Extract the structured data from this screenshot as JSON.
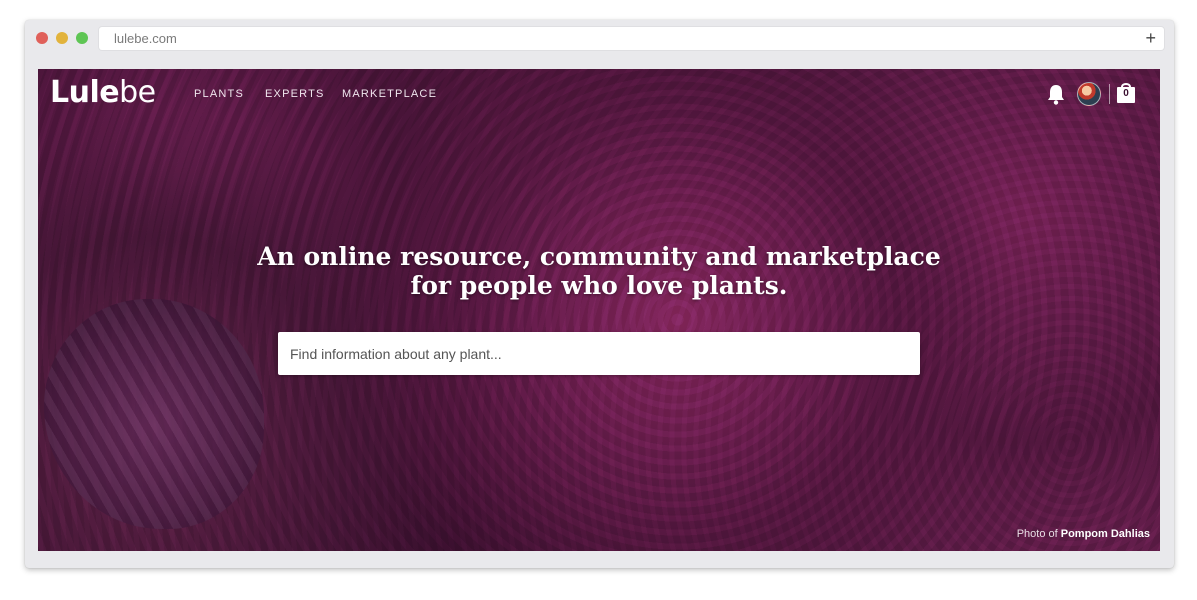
{
  "browser": {
    "url": "lulebe.com",
    "new_tab_symbol": "+",
    "traffic_lights": {
      "close": "#e0605a",
      "minimize": "#e2b33c",
      "maximize": "#5ec554"
    }
  },
  "site": {
    "logo_bold": "Lule",
    "logo_light": "be",
    "nav": [
      {
        "label": "PLANTS"
      },
      {
        "label": "EXPERTS"
      },
      {
        "label": "MARKETPLACE"
      }
    ],
    "icons": {
      "notification": "bell-icon",
      "avatar": "user-avatar",
      "cart": "shopping-bag-icon"
    },
    "cart_count": "0"
  },
  "hero": {
    "headline": "An online resource, community and marketplace for people who love plants.",
    "search_placeholder": "Find information about any plant...",
    "photo_credit_prefix": "Photo of ",
    "photo_credit_subject": "Pompom Dahlias"
  },
  "colors": {
    "hero_magenta": "#8e2a68",
    "text_white": "#ffffff"
  }
}
